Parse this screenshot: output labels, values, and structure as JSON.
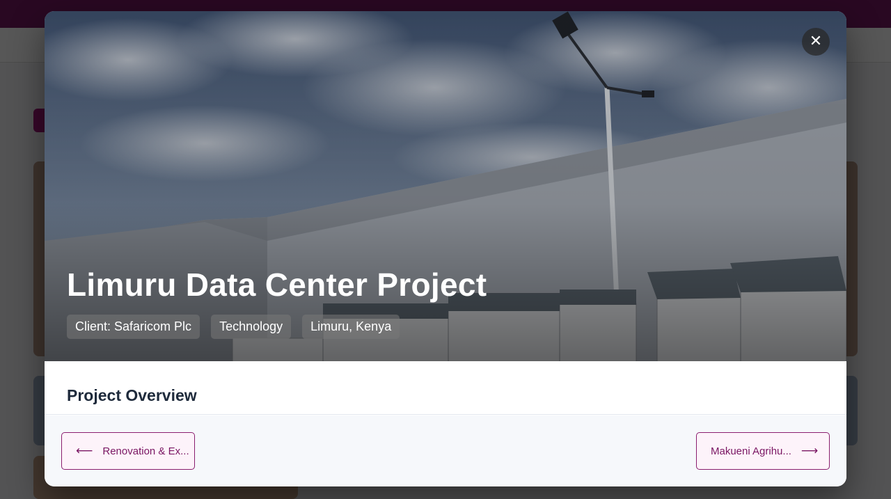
{
  "modal": {
    "title": "Limuru Data Center Project",
    "close_icon_glyph": "✕",
    "tags": [
      "Client: Safaricom Plc",
      "Technology",
      "Limuru, Kenya"
    ],
    "section_title": "Project Overview",
    "prev_label": "Renovation & Ex...",
    "next_label": "Makueni Agrihu...",
    "prev_icon": "arrow-left-icon",
    "next_icon": "arrow-right-icon",
    "prev_arrow_glyph": "⟵",
    "next_arrow_glyph": "⟶"
  },
  "colors": {
    "accent": "#7a1663",
    "brand_bar": "#7a1a63",
    "section_title": "#1e2a3b"
  }
}
